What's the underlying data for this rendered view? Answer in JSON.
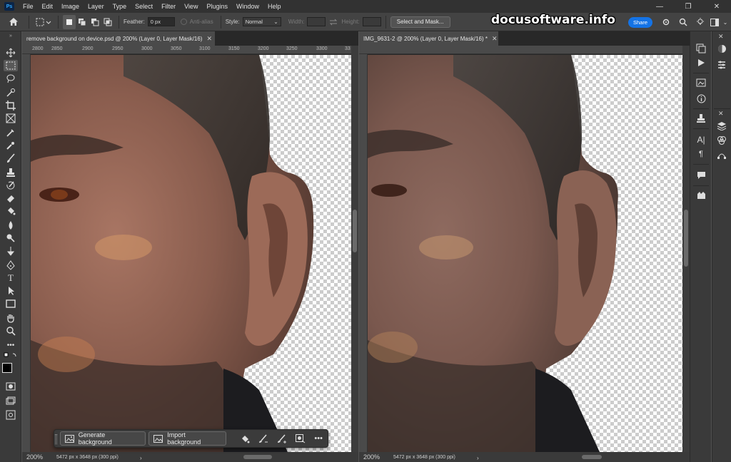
{
  "app": {
    "logo": "Ps"
  },
  "menu": [
    "File",
    "Edit",
    "Image",
    "Layer",
    "Type",
    "Select",
    "Filter",
    "View",
    "Plugins",
    "Window",
    "Help"
  ],
  "window_controls": {
    "minimize": "—",
    "restore": "❐",
    "close": "✕"
  },
  "options": {
    "feather_label": "Feather:",
    "feather_value": "0 px",
    "antialias_label": "Anti-alias",
    "style_label": "Style:",
    "style_value": "Normal",
    "width_label": "Width:",
    "height_label": "Height:",
    "select_mask_label": "Select and Mask...",
    "share_label": "Share"
  },
  "watermark": "docusoftware.info",
  "documents": [
    {
      "tab_title": "remove background on device.psd @ 200% (Layer 0, Layer Mask/16)",
      "ruler_ticks": [
        "2800",
        "2850",
        "2900",
        "2950",
        "3000",
        "3050",
        "3100",
        "3150",
        "3200",
        "3250",
        "3300",
        "33"
      ],
      "zoom": "200%",
      "doc_info": "5472 px x 3648 px (300 ppi)"
    },
    {
      "tab_title": "IMG_9631-2 @ 200% (Layer 0, Layer Mask/16) *",
      "zoom": "200%",
      "doc_info": "5472 px x 3648 px (300 ppi)"
    }
  ],
  "taskbar": {
    "generate_label": "Generate background",
    "import_label": "Import background"
  }
}
